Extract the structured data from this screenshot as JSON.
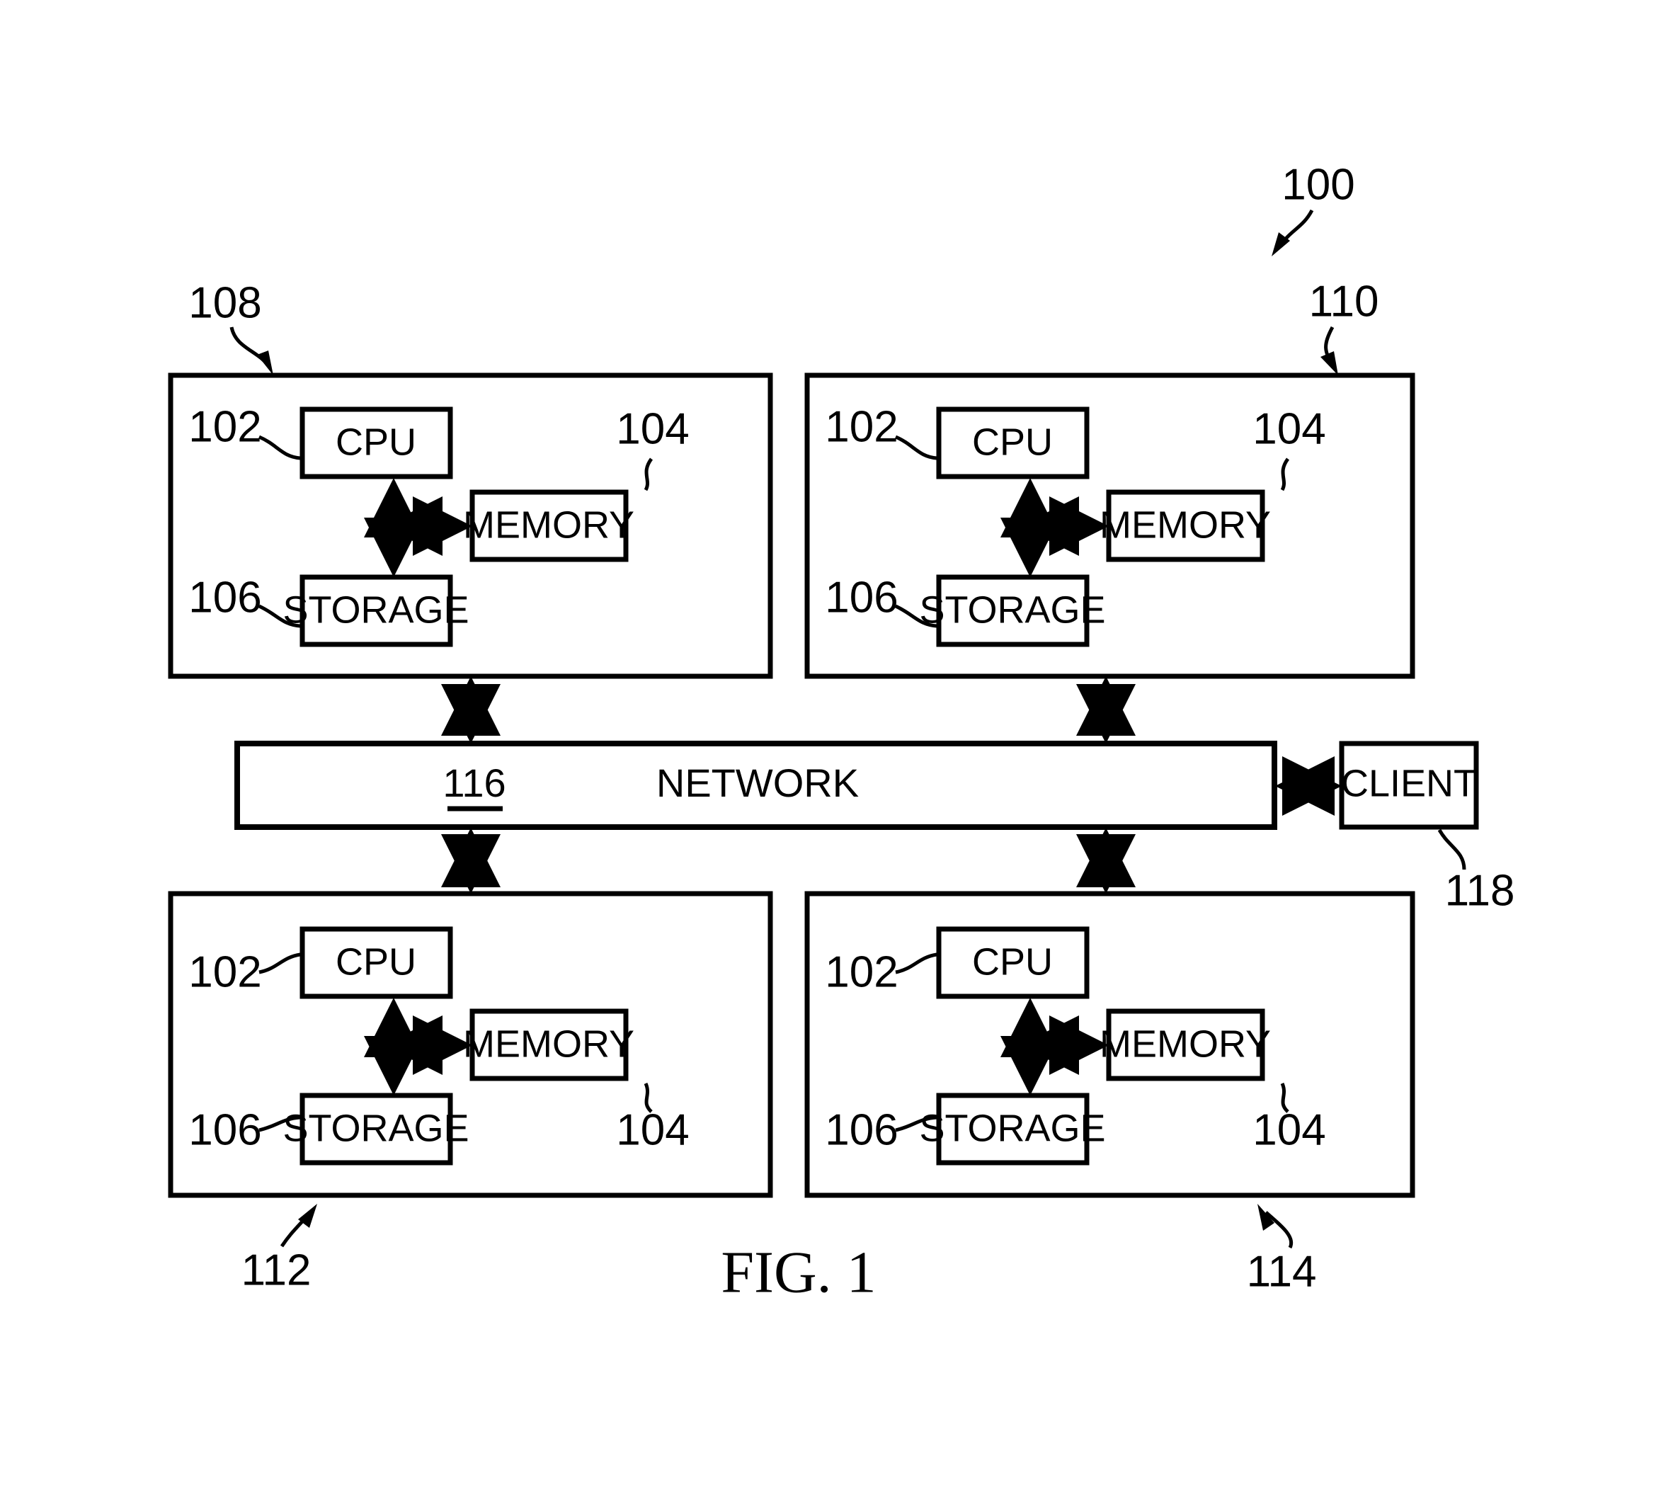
{
  "figure": {
    "caption": "FIG. 1",
    "system_ref": "100"
  },
  "network": {
    "ref": "116",
    "label": "NETWORK"
  },
  "client": {
    "label": "CLIENT",
    "ref": "118"
  },
  "component_labels": {
    "cpu": "CPU",
    "memory": "MEMORY",
    "storage": "STORAGE",
    "cpu_ref": "102",
    "memory_ref": "104",
    "storage_ref": "106"
  },
  "nodes": [
    {
      "id": "node-top-left",
      "ref": "108",
      "cpu": "CPU",
      "memory": "MEMORY",
      "storage": "STORAGE",
      "cpu_ref": "102",
      "memory_ref": "104",
      "storage_ref": "106"
    },
    {
      "id": "node-top-right",
      "ref": "110",
      "cpu": "CPU",
      "memory": "MEMORY",
      "storage": "STORAGE",
      "cpu_ref": "102",
      "memory_ref": "104",
      "storage_ref": "106"
    },
    {
      "id": "node-bottom-left",
      "ref": "112",
      "cpu": "CPU",
      "memory": "MEMORY",
      "storage": "STORAGE",
      "cpu_ref": "102",
      "memory_ref": "104",
      "storage_ref": "106"
    },
    {
      "id": "node-bottom-right",
      "ref": "114",
      "cpu": "CPU",
      "memory": "MEMORY",
      "storage": "STORAGE",
      "cpu_ref": "102",
      "memory_ref": "104",
      "storage_ref": "106"
    }
  ],
  "colors": {
    "ink": "#000000",
    "paper": "#ffffff"
  }
}
